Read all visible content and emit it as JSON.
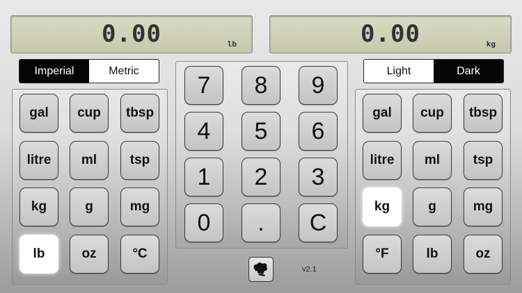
{
  "displays": {
    "left": {
      "value": "0.00",
      "unit": "lb"
    },
    "right": {
      "value": "0.00",
      "unit": "kg"
    }
  },
  "system_toggle": {
    "imperial": "Imperial",
    "metric": "Metric",
    "selected": "Imperial"
  },
  "theme_toggle": {
    "light": "Light",
    "dark": "Dark",
    "selected": "Dark"
  },
  "left_units": [
    "gal",
    "cup",
    "tbsp",
    "litre",
    "ml",
    "tsp",
    "kg",
    "g",
    "mg",
    "lb",
    "oz",
    "°C"
  ],
  "right_units": [
    "gal",
    "cup",
    "tbsp",
    "litre",
    "ml",
    "tsp",
    "kg",
    "g",
    "mg",
    "°F",
    "lb",
    "oz"
  ],
  "left_selected": "lb",
  "right_selected": "kg",
  "keypad": [
    "7",
    "8",
    "9",
    "4",
    "5",
    "6",
    "1",
    "2",
    "3",
    "0",
    ".",
    "C"
  ],
  "chef_icon": "chef-hat-icon",
  "version": "v2.1"
}
